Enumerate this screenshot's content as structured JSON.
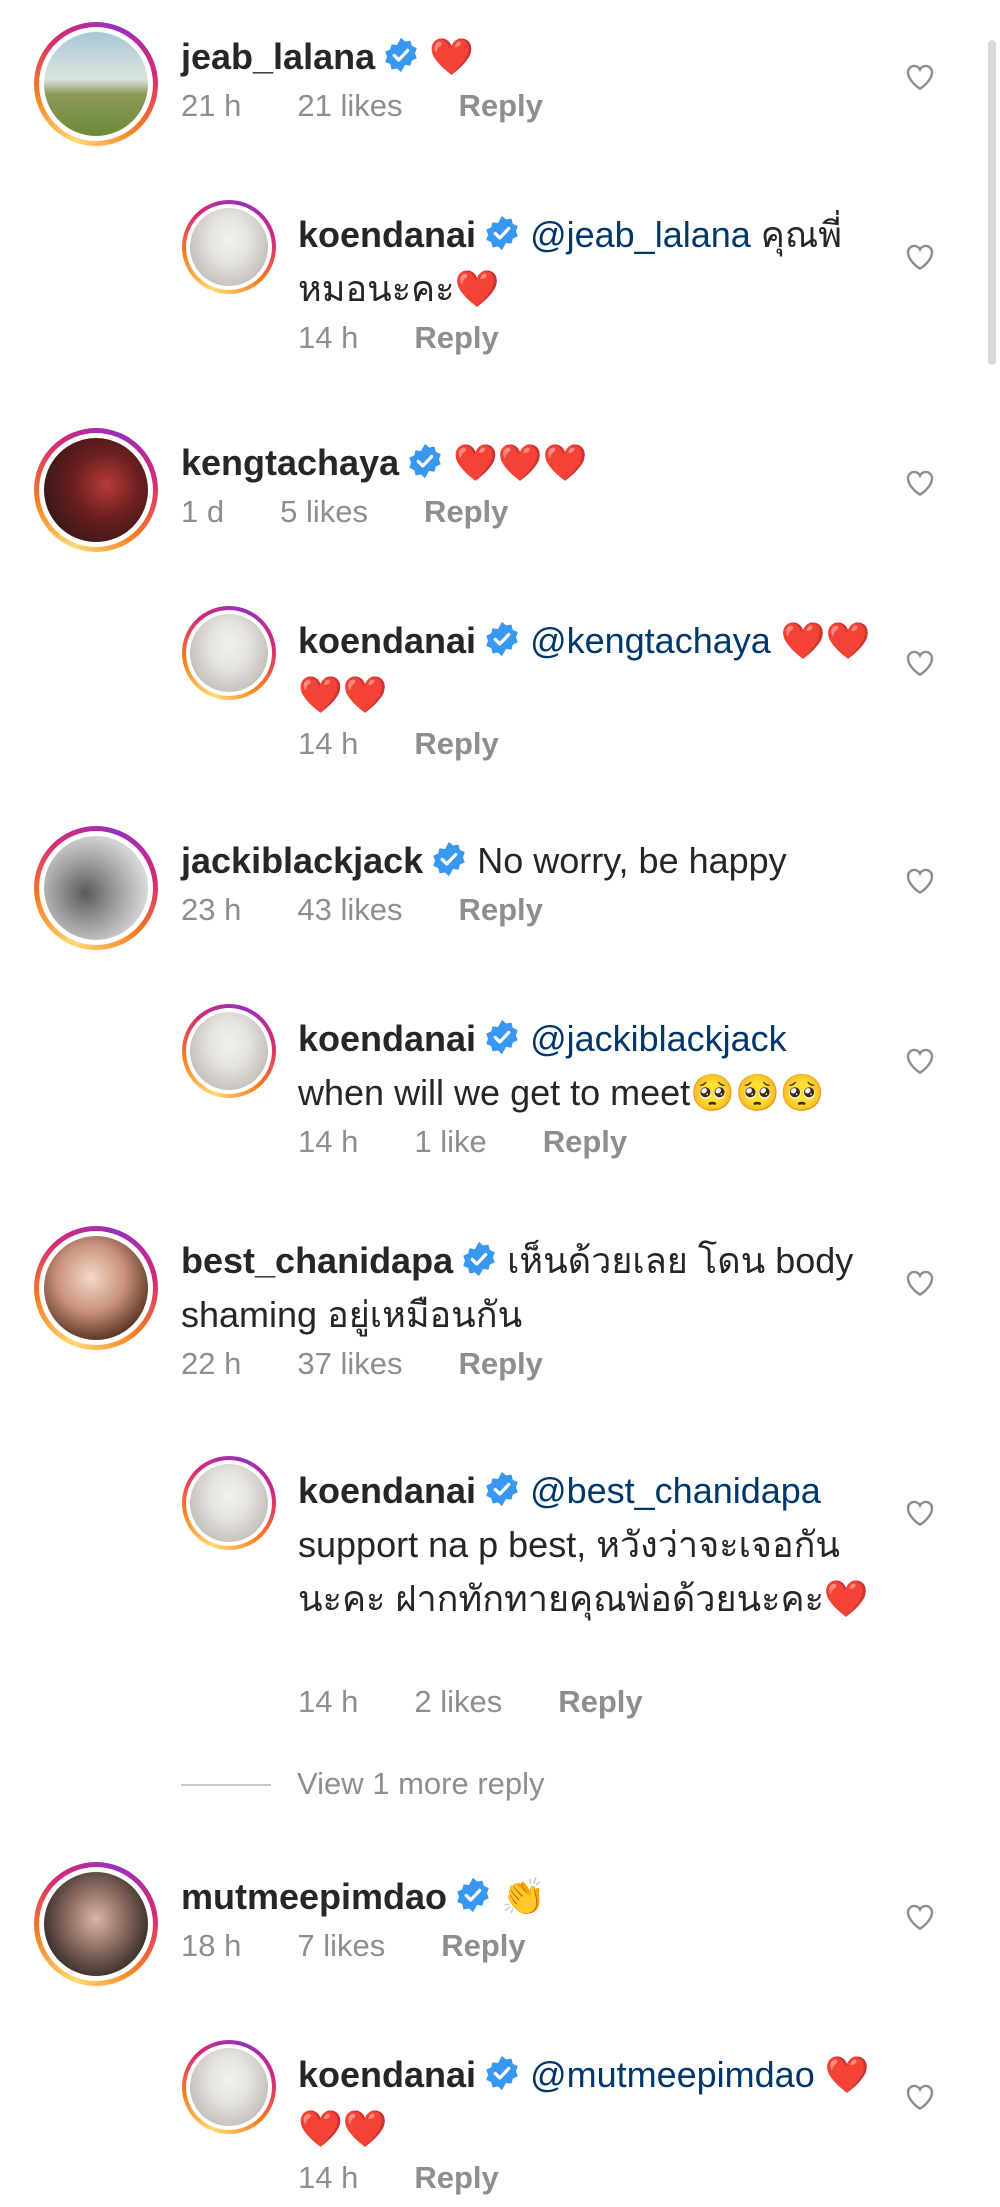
{
  "colors": {
    "heart": "#ed1c2e",
    "mention": "#00376b",
    "meta": "#8e8e8e",
    "verified": "#3897f0"
  },
  "comments": [
    {
      "username": "jeab_lalana",
      "text": "❤️",
      "time": "21 h",
      "likes": "21 likes",
      "reply": "Reply"
    },
    {
      "username": "koendanai",
      "mention": "@jeab_lalana",
      "text": "คุณพี่หมอนะคะ❤️",
      "time": "14 h",
      "reply": "Reply"
    },
    {
      "username": "kengtachaya",
      "text": "❤️❤️❤️",
      "time": "1 d",
      "likes": "5 likes",
      "reply": "Reply"
    },
    {
      "username": "koendanai",
      "mention": "@kengtachaya",
      "text": "❤️❤️❤️❤️",
      "time": "14 h",
      "reply": "Reply"
    },
    {
      "username": "jackiblackjack",
      "text": "No worry, be happy",
      "time": "23 h",
      "likes": "43 likes",
      "reply": "Reply"
    },
    {
      "username": "koendanai",
      "mention": "@jackiblackjack",
      "text": "when will we get to meet🥺🥺🥺",
      "time": "14 h",
      "likes": "1 like",
      "reply": "Reply"
    },
    {
      "username": "best_chanidapa",
      "text": "เห็นด้วยเลย โดน body shaming อยู่เหมือนกัน",
      "time": "22 h",
      "likes": "37 likes",
      "reply": "Reply"
    },
    {
      "username": "koendanai",
      "mention": "@best_chanidapa",
      "text": "support na p best, หวังว่าจะเจอกันนะคะ ฝากทักทายคุณพ่อด้วยนะคะ❤️",
      "time": "14 h",
      "likes": "2 likes",
      "reply": "Reply"
    },
    {
      "username": "mutmeepimdao",
      "text": "👏",
      "time": "18 h",
      "likes": "7 likes",
      "reply": "Reply"
    },
    {
      "username": "koendanai",
      "mention": "@mutmeepimdao",
      "text": "❤️❤️❤️",
      "time": "14 h",
      "reply": "Reply"
    }
  ],
  "view_more": "View 1 more reply",
  "icons": {
    "like": "heart-outline-icon",
    "verified": "verified-badge-icon"
  }
}
